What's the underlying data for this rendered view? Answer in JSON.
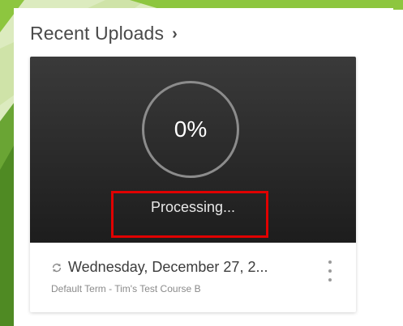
{
  "colors": {
    "slide_green": "#8dc63f",
    "slide_green_light": "#d8e9b8",
    "thumb_dark": "#262626",
    "highlight_red": "#e00000"
  },
  "header": {
    "title": "Recent Uploads",
    "chevron": "›",
    "chevron_icon": "chevron-right-icon"
  },
  "upload": {
    "progress_percent": 0,
    "progress_label": "0%",
    "status": "Processing...",
    "title": "Wednesday, December 27, 2...",
    "subtitle": "Default Term - Tim's Test Course B",
    "status_icon": "sync-icon",
    "menu_icon": "more-vertical-icon"
  }
}
